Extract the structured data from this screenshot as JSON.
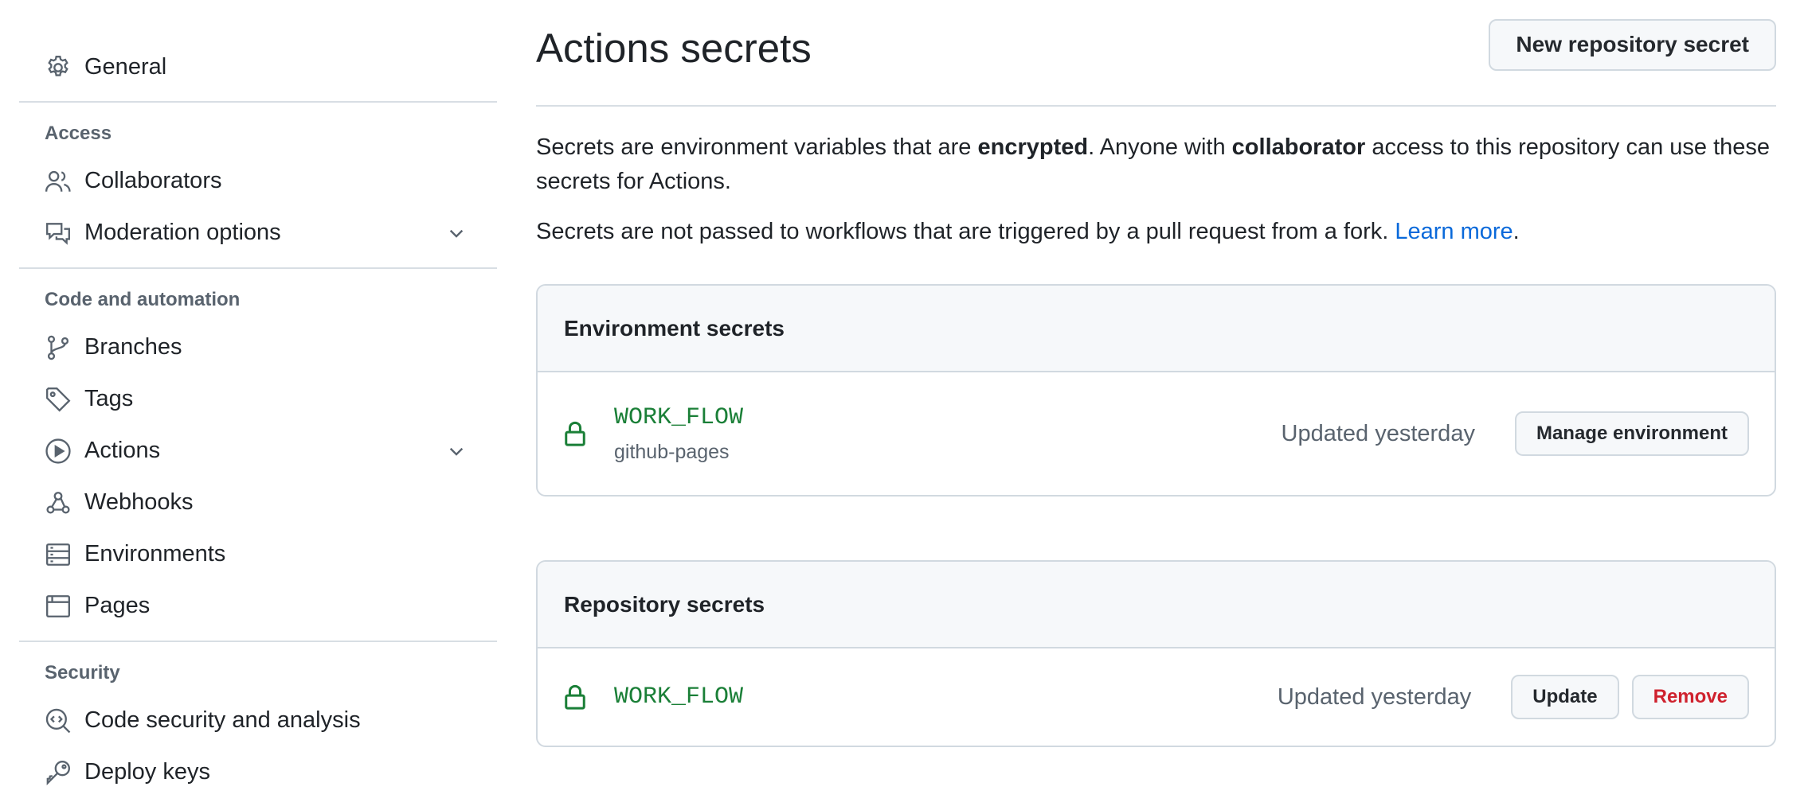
{
  "sidebar": {
    "general": {
      "label": "General",
      "icon": "gear-icon"
    },
    "access": {
      "heading": "Access",
      "items": [
        {
          "label": "Collaborators",
          "icon": "people-icon"
        },
        {
          "label": "Moderation options",
          "icon": "comment-discussion-icon",
          "expandable": true
        }
      ]
    },
    "code_automation": {
      "heading": "Code and automation",
      "items": [
        {
          "label": "Branches",
          "icon": "git-branch-icon"
        },
        {
          "label": "Tags",
          "icon": "tag-icon"
        },
        {
          "label": "Actions",
          "icon": "play-icon",
          "expandable": true
        },
        {
          "label": "Webhooks",
          "icon": "webhook-icon"
        },
        {
          "label": "Environments",
          "icon": "server-icon"
        },
        {
          "label": "Pages",
          "icon": "browser-icon"
        }
      ]
    },
    "security": {
      "heading": "Security",
      "items": [
        {
          "label": "Code security and analysis",
          "icon": "codescan-icon"
        },
        {
          "label": "Deploy keys",
          "icon": "key-icon"
        }
      ]
    }
  },
  "main": {
    "title": "Actions secrets",
    "new_secret_button": "New repository secret",
    "description": {
      "part1": "Secrets are environment variables that are ",
      "bold1": "encrypted",
      "part2": ". Anyone with ",
      "bold2": "collaborator",
      "part3": " access to this repository can use these secrets for Actions."
    },
    "fork_note": {
      "text": "Secrets are not passed to workflows that are triggered by a pull request from a fork. ",
      "link": "Learn more",
      "end": "."
    },
    "environment_secrets": {
      "heading": "Environment secrets",
      "rows": [
        {
          "name": "WORK_FLOW",
          "environment": "github-pages",
          "updated": "Updated yesterday",
          "action": "Manage environment"
        }
      ]
    },
    "repository_secrets": {
      "heading": "Repository secrets",
      "rows": [
        {
          "name": "WORK_FLOW",
          "updated": "Updated yesterday",
          "update_label": "Update",
          "remove_label": "Remove"
        }
      ]
    }
  },
  "colors": {
    "accent_link": "#0969da",
    "secret_green": "#1a7f37",
    "danger": "#cf222e",
    "muted": "#59636e",
    "border": "#d1d9e0"
  }
}
